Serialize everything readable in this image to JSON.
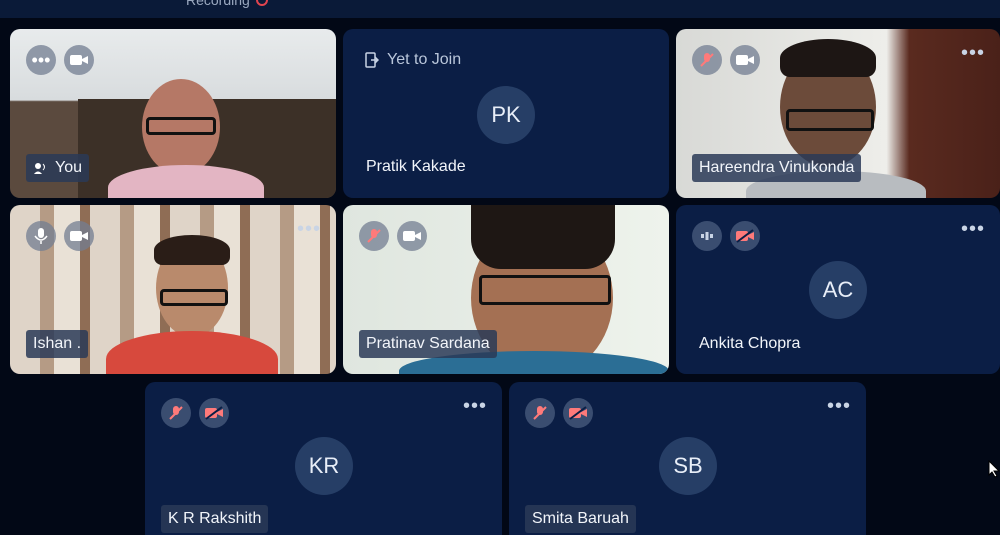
{
  "meeting": {
    "recording_label": "Recording"
  },
  "participants": [
    {
      "name": "You",
      "avatar_initials": "",
      "status": "",
      "video": true,
      "mic_icon": "speaking-icon",
      "controls": [
        "more-icon",
        "camera-icon"
      ]
    },
    {
      "name": "Pratik Kakade",
      "avatar_initials": "PK",
      "status": "Yet to Join",
      "video": false
    },
    {
      "name": "Hareendra Vinukonda",
      "avatar_initials": "",
      "status": "",
      "video": true,
      "controls": [
        "mic-muted-icon",
        "camera-icon",
        "more-icon"
      ]
    },
    {
      "name": "Ishan .",
      "avatar_initials": "",
      "status": "",
      "video": true,
      "controls": [
        "mic-icon",
        "camera-icon",
        "more-icon"
      ]
    },
    {
      "name": "Pratinav Sardana",
      "avatar_initials": "",
      "status": "",
      "video": true,
      "controls": [
        "mic-muted-icon",
        "camera-icon"
      ]
    },
    {
      "name": "Ankita Chopra",
      "avatar_initials": "AC",
      "status": "",
      "video": false,
      "controls": [
        "audio-level-icon",
        "camera-off-icon",
        "more-icon"
      ]
    },
    {
      "name": "K R Rakshith",
      "avatar_initials": "KR",
      "status": "",
      "video": false,
      "controls": [
        "mic-muted-icon",
        "camera-off-icon",
        "more-icon"
      ]
    },
    {
      "name": "Smita Baruah",
      "avatar_initials": "SB",
      "status": "",
      "video": false,
      "controls": [
        "mic-muted-icon",
        "camera-off-icon",
        "more-icon"
      ]
    }
  ],
  "colors": {
    "background": "#020816",
    "tile": "#0b1e45",
    "accent": "#e0444f"
  }
}
